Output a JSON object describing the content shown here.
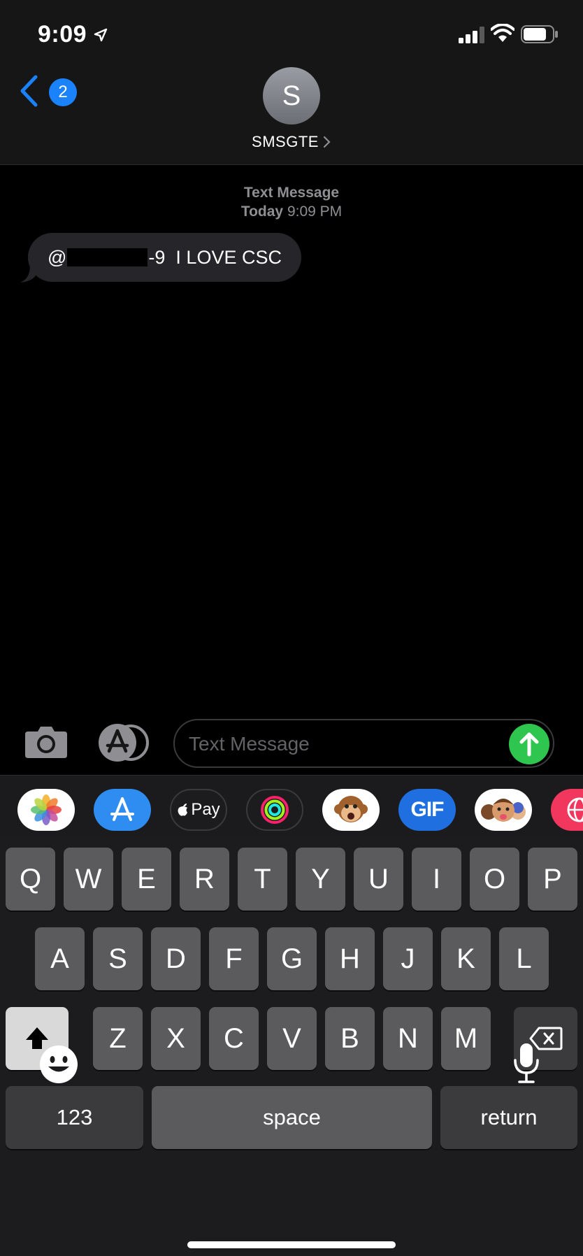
{
  "status_bar": {
    "time": "9:09",
    "location_icon": "location-arrow-icon",
    "signal_icon": "cellular-signal-icon",
    "wifi_icon": "wifi-icon",
    "battery_icon": "battery-icon"
  },
  "header": {
    "back_badge": "2",
    "avatar_initial": "S",
    "contact_name": "SMSGTE"
  },
  "conversation": {
    "meta_title": "Text Message",
    "meta_day": "Today",
    "meta_time": "9:09 PM",
    "messages": [
      {
        "prefix": "@",
        "suffix": "-9  I LOVE CSC",
        "redacted": true
      }
    ]
  },
  "input": {
    "placeholder": "Text Message",
    "value": ""
  },
  "app_drawer": [
    {
      "name": "photos-app",
      "icon": "photos-icon"
    },
    {
      "name": "app-store-app",
      "icon": "app-store-icon"
    },
    {
      "name": "apple-pay-app",
      "icon": "apple-pay-icon",
      "label": "Pay"
    },
    {
      "name": "activity-app",
      "icon": "activity-rings-icon"
    },
    {
      "name": "animoji-app",
      "icon": "monkey-animoji-icon"
    },
    {
      "name": "gif-app",
      "icon": "gif-icon",
      "label": "GIF"
    },
    {
      "name": "memoji-app",
      "icon": "memoji-icon"
    },
    {
      "name": "web-app",
      "icon": "globe-icon"
    }
  ],
  "keyboard": {
    "row1": [
      "Q",
      "W",
      "E",
      "R",
      "T",
      "Y",
      "U",
      "I",
      "O",
      "P"
    ],
    "row2": [
      "A",
      "S",
      "D",
      "F",
      "G",
      "H",
      "J",
      "K",
      "L"
    ],
    "row3": [
      "Z",
      "X",
      "C",
      "V",
      "B",
      "N",
      "M"
    ],
    "numbers_label": "123",
    "space_label": "space",
    "return_label": "return"
  },
  "colors": {
    "accent": "#1a82fb",
    "send": "#2fc64f",
    "bubble": "#26252a",
    "key": "#5b5b5e",
    "key_dark": "#3b3b3e",
    "keyboard_bg": "#1c1c1e"
  }
}
